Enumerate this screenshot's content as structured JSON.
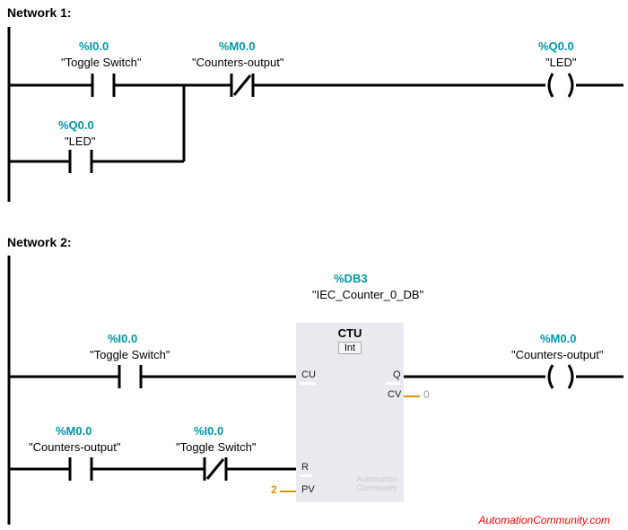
{
  "network1": {
    "title": "Network 1:",
    "contacts": {
      "c1": {
        "addr": "%I0.0",
        "desc": "\"Toggle Switch\""
      },
      "c2": {
        "addr": "%M0.0",
        "desc": "\"Counters-output\""
      },
      "c3": {
        "addr": "%Q0.0",
        "desc": "\"LED\""
      },
      "c4": {
        "addr": "%Q0.0",
        "desc": "\"LED\""
      }
    }
  },
  "network2": {
    "title": "Network 2:",
    "counter": {
      "addr": "%DB3",
      "desc": "\"IEC_Counter_0_DB\"",
      "type": "CTU",
      "datatype": "Int",
      "pv": "2",
      "cv": "0"
    },
    "contacts": {
      "c1": {
        "addr": "%I0.0",
        "desc": "\"Toggle Switch\""
      },
      "c2": {
        "addr": "%M0.0",
        "desc": "\"Counters-output\""
      },
      "c3": {
        "addr": "%M0.0",
        "desc": "\"Counters-output\""
      },
      "c4": {
        "addr": "%I0.0",
        "desc": "\"Toggle Switch\""
      }
    },
    "ports": {
      "cu": "CU",
      "r": "R",
      "pv": "PV",
      "q": "Q",
      "cv": "CV"
    }
  },
  "watermark": "AutomationCommunity.com",
  "faint": "Automation\nCommunity"
}
